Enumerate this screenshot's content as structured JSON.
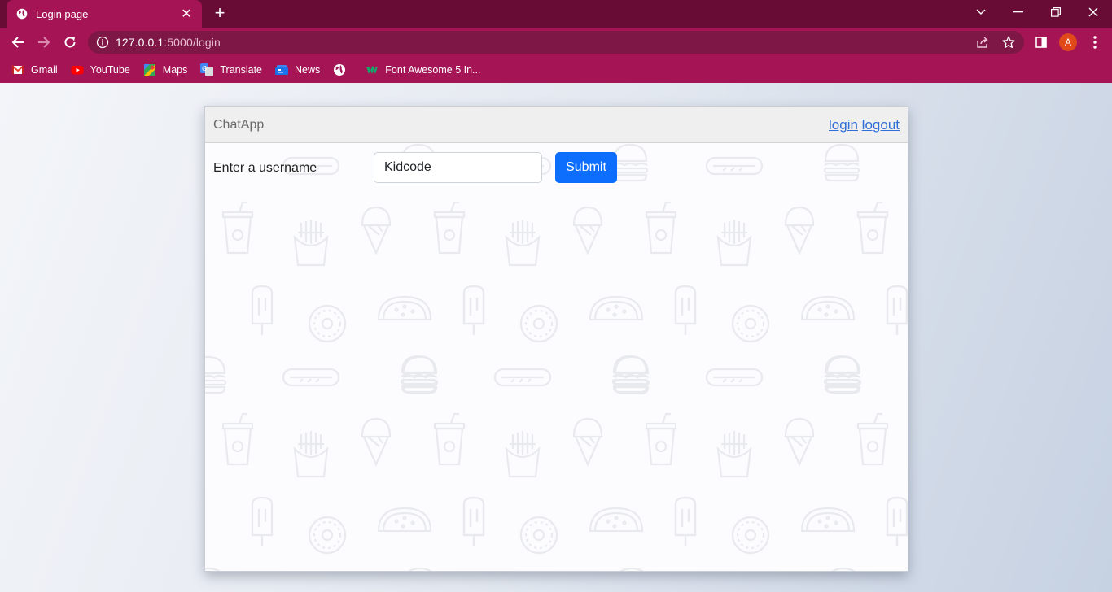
{
  "browser": {
    "tab_title": "Login page",
    "tab_close": "✕",
    "new_tab": "+",
    "url_host": "127.0.0.1",
    "url_path": ":5000/login",
    "avatar_letter": "A",
    "bookmarks": [
      {
        "label": "Gmail",
        "icon": "gmail-icon"
      },
      {
        "label": "YouTube",
        "icon": "youtube-icon"
      },
      {
        "label": "Maps",
        "icon": "maps-icon"
      },
      {
        "label": "Translate",
        "icon": "translate-icon"
      },
      {
        "label": "News",
        "icon": "news-icon"
      },
      {
        "label": "",
        "icon": "globe-icon"
      },
      {
        "label": "Font Awesome 5 In...",
        "icon": "font-awesome-icon"
      }
    ],
    "colors": {
      "tab_strip": "#680c35",
      "toolbar": "#a51454",
      "omnibox": "#7e1746"
    }
  },
  "app": {
    "brand": "ChatApp",
    "nav_login": "login",
    "nav_logout": "logout",
    "form": {
      "label": "Enter a username",
      "username_value": "Kidcode",
      "submit_label": "Submit"
    },
    "colors": {
      "primary": "#0d6efd",
      "link": "#2f6fd8"
    }
  }
}
